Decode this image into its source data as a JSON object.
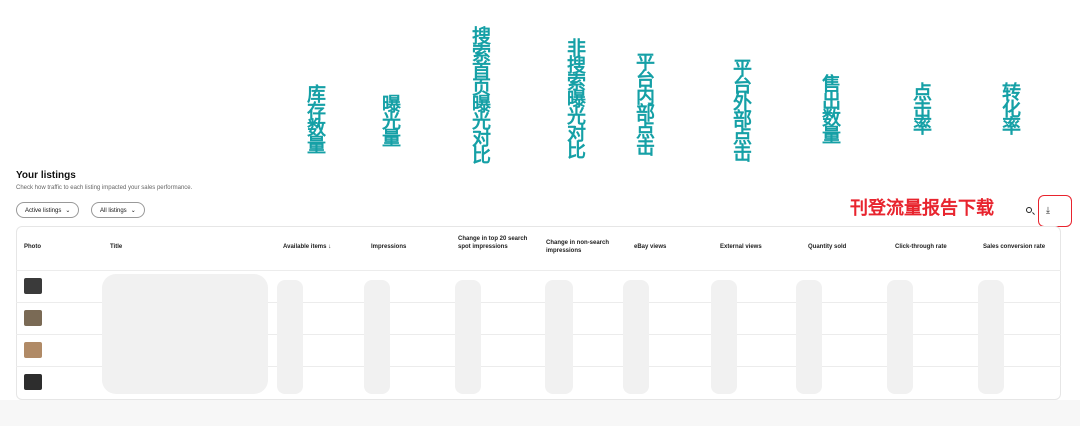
{
  "page": {
    "title": "Your listings",
    "subtitle": "Check how traffic to each listing impacted your sales performance."
  },
  "filters": {
    "status_label": "Active listings",
    "category_label": "All listings",
    "chevron": "⌄"
  },
  "toolbar": {
    "report_annotation": "刊登流量报告下载",
    "search_icon": "search-icon",
    "download_icon": "download-icon",
    "download_glyph": "⤓"
  },
  "columns": [
    {
      "label": "Photo"
    },
    {
      "label": "Title"
    },
    {
      "label": "Available items ↓"
    },
    {
      "label": "Impressions"
    },
    {
      "label": "Change in top 20 search spot impressions"
    },
    {
      "label": "Change in non-search impressions"
    },
    {
      "label": "eBay views"
    },
    {
      "label": "External views"
    },
    {
      "label": "Quantity sold"
    },
    {
      "label": "Click-through rate"
    },
    {
      "label": "Sales conversion rate"
    }
  ],
  "annotations": [
    {
      "text": "库存数量"
    },
    {
      "text": "曝光量"
    },
    {
      "text": "搜索首页曝光对比"
    },
    {
      "text": "非搜索曝光对比"
    },
    {
      "text": "平台内部点击"
    },
    {
      "text": "平台外部点击"
    },
    {
      "text": "售出数量"
    },
    {
      "text": "点击率"
    },
    {
      "text": "转化率"
    }
  ],
  "rows": [
    {
      "thumb_color": "#3a3a3a"
    },
    {
      "thumb_color": "#7a6a55"
    },
    {
      "thumb_color": "#b08a66"
    },
    {
      "thumb_color": "#2d2d2d"
    }
  ]
}
